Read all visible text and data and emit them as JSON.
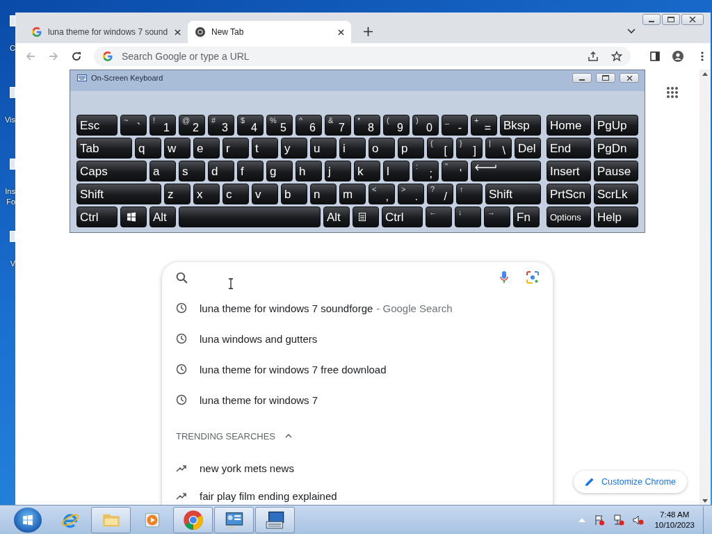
{
  "desktop": {
    "icons": [
      {
        "lines": [
          "C"
        ]
      },
      {
        "lines": [
          "Vis"
        ]
      },
      {
        "lines": [
          "Ins",
          "Fo"
        ]
      },
      {
        "lines": [
          "V"
        ]
      }
    ]
  },
  "browser": {
    "tabs": [
      {
        "title": "luna theme for windows 7 sound",
        "selected": false
      },
      {
        "title": "New Tab",
        "selected": true
      }
    ],
    "omnibox": {
      "placeholder": "Search Google or type a URL"
    },
    "search": {
      "suggestions": [
        {
          "text": "luna theme for windows 7 soundforge",
          "suffix": "- Google Search"
        },
        {
          "text": "luna windows and gutters"
        },
        {
          "text": "luna theme for windows 7 free download"
        },
        {
          "text": "luna theme for windows 7"
        }
      ],
      "trending_header": "TRENDING SEARCHES",
      "trending_expanded": true,
      "trending": [
        "new york mets news",
        "fair play film ending explained"
      ]
    },
    "customize_button": "Customize Chrome"
  },
  "keyboard": {
    "title": "On-Screen Keyboard",
    "key_rows": [
      {
        "keys": [
          {
            "label": "Esc"
          },
          {
            "label": "`",
            "shift": "~"
          },
          {
            "label": "1",
            "shift": "!"
          },
          {
            "label": "2",
            "shift": "@"
          },
          {
            "label": "3",
            "shift": "#"
          },
          {
            "label": "4",
            "shift": "$"
          },
          {
            "label": "5",
            "shift": "%"
          },
          {
            "label": "6",
            "shift": "^"
          },
          {
            "label": "7",
            "shift": "&"
          },
          {
            "label": "8",
            "shift": "*"
          },
          {
            "label": "9",
            "shift": "("
          },
          {
            "label": "0",
            "shift": ")"
          },
          {
            "label": "-",
            "shift": "_"
          },
          {
            "label": "=",
            "shift": "+"
          },
          {
            "label": "Bksp"
          }
        ]
      },
      {
        "keys": [
          {
            "label": "Tab"
          },
          {
            "label": "q"
          },
          {
            "label": "w"
          },
          {
            "label": "e"
          },
          {
            "label": "r"
          },
          {
            "label": "t"
          },
          {
            "label": "y"
          },
          {
            "label": "u"
          },
          {
            "label": "i"
          },
          {
            "label": "o"
          },
          {
            "label": "p"
          },
          {
            "label": "[",
            "shift": "{"
          },
          {
            "label": "]",
            "shift": "}"
          },
          {
            "label": "\\",
            "shift": "|"
          },
          {
            "label": "Del"
          }
        ]
      },
      {
        "keys": [
          {
            "label": "Caps"
          },
          {
            "label": "a"
          },
          {
            "label": "s"
          },
          {
            "label": "d"
          },
          {
            "label": "f"
          },
          {
            "label": "g"
          },
          {
            "label": "h"
          },
          {
            "label": "j"
          },
          {
            "label": "k"
          },
          {
            "label": "l"
          },
          {
            "label": ";",
            "shift": ":"
          },
          {
            "label": "'",
            "shift": "\""
          },
          {
            "kind": "enter"
          }
        ]
      },
      {
        "keys": [
          {
            "label": "Shift"
          },
          {
            "label": "z"
          },
          {
            "label": "x"
          },
          {
            "label": "c"
          },
          {
            "label": "v"
          },
          {
            "label": "b"
          },
          {
            "label": "n"
          },
          {
            "label": "m"
          },
          {
            "label": ",",
            "shift": "<"
          },
          {
            "label": ".",
            "shift": ">"
          },
          {
            "label": "/",
            "shift": "?"
          },
          {
            "shift": "↑"
          },
          {
            "label": "Shift"
          }
        ]
      },
      {
        "keys": [
          {
            "label": "Ctrl"
          },
          {
            "kind": "windows"
          },
          {
            "label": "Alt"
          },
          {
            "kind": "space"
          },
          {
            "label": "Alt"
          },
          {
            "kind": "menu"
          },
          {
            "label": "Ctrl"
          },
          {
            "shift": "←"
          },
          {
            "shift": "↓"
          },
          {
            "shift": "→"
          },
          {
            "label": "Fn"
          }
        ]
      }
    ],
    "side_rows": [
      [
        {
          "label": "Home"
        },
        {
          "label": "PgUp"
        }
      ],
      [
        {
          "label": "End"
        },
        {
          "label": "PgDn"
        }
      ],
      [
        {
          "label": "Insert"
        },
        {
          "label": "Pause"
        }
      ],
      [
        {
          "label": "PrtScn"
        },
        {
          "label": "ScrLk"
        }
      ],
      [
        {
          "label": "Options",
          "kind": "small"
        },
        {
          "label": "Help"
        }
      ]
    ]
  },
  "taskbar": {
    "buttons": [
      {
        "kind": "ie",
        "running": false
      },
      {
        "kind": "explorer",
        "running": true
      },
      {
        "kind": "media",
        "running": false
      },
      {
        "kind": "chrome",
        "running": true
      },
      {
        "kind": "control",
        "running": true
      },
      {
        "kind": "keyboard",
        "running": true
      }
    ],
    "clock": {
      "time": "7:48 AM",
      "date": "10/10/2023"
    }
  }
}
